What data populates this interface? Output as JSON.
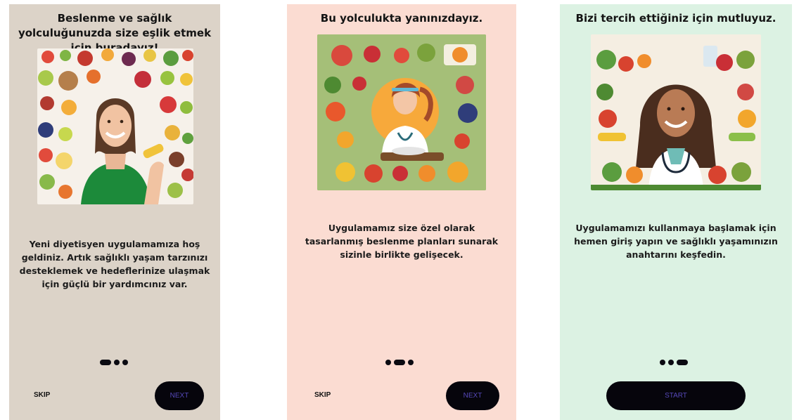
{
  "screens": [
    {
      "title": "Beslenme ve sağlık yolculuğunuzda size eşlik etmek için buradayız!",
      "body": "Yeni diyetisyen uygulamamıza hoş geldiniz. Artık sağlıklı yaşam tarzınızı desteklemek ve hedeflerinize ulaşmak için güçlü bir yardımcınız var.",
      "skip_label": "SKIP",
      "next_label": "NEXT",
      "active_dot": 1,
      "bg_color": "#dcd3c8"
    },
    {
      "title": "Bu yolculukta yanınızdayız.",
      "body": "Uygulamamız size özel olarak tasarlanmış beslenme planları sunarak sizinle birlikte gelişecek.",
      "skip_label": "SKIP",
      "next_label": "NEXT",
      "active_dot": 2,
      "bg_color": "#fbdcd2"
    },
    {
      "title": "Bizi tercih ettiğiniz için mutluyuz.",
      "body": "Uygulamamızı kullanmaya başlamak için hemen giriş yapın ve sağlıklı yaşamınızın anahtarını keşfedin.",
      "start_label": "START",
      "active_dot": 3,
      "bg_color": "#dcf2e3"
    }
  ],
  "colors": {
    "button_bg": "#06050c",
    "button_text": "#5548b8",
    "dot_color": "#0b0b12"
  }
}
